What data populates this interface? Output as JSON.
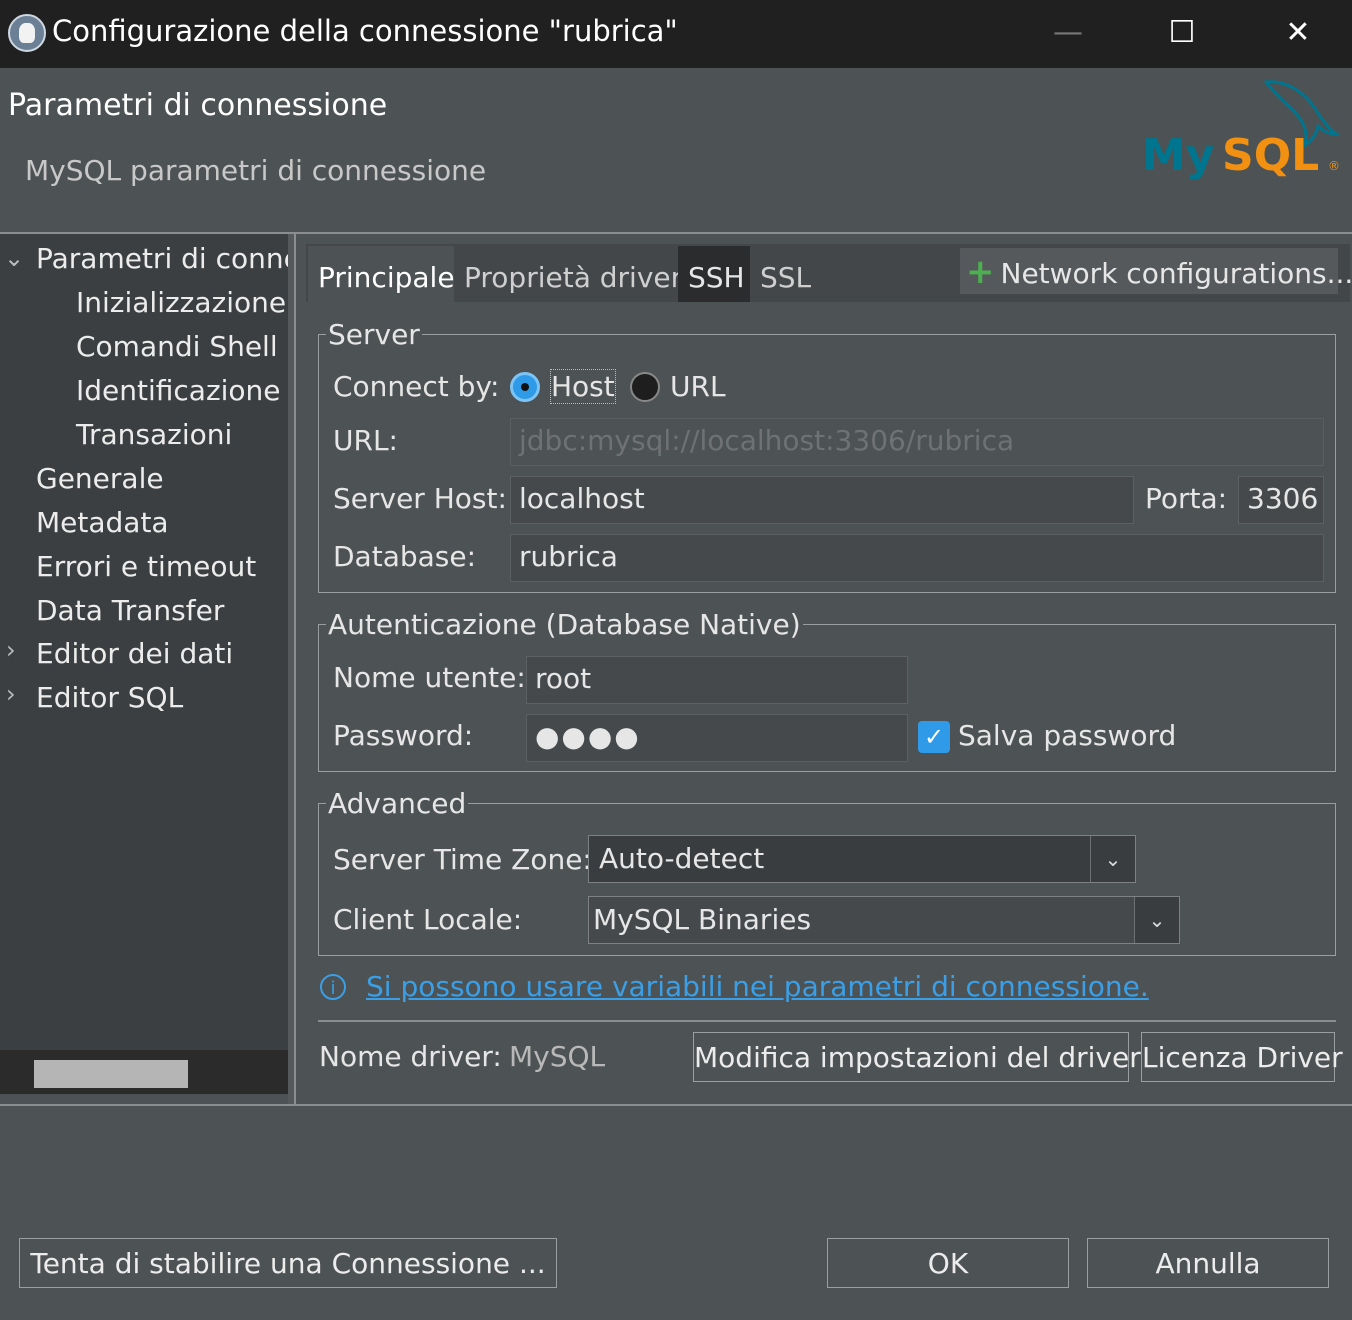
{
  "window": {
    "title": "Configurazione della connessione \"rubrica\"",
    "minimize": "—",
    "maximize": "☐",
    "close": "✕"
  },
  "header": {
    "title": "Parametri di connessione",
    "subtitle": "MySQL parametri di connessione",
    "logo_text": "MySQL"
  },
  "nav": {
    "items": [
      {
        "label": "Parametri di connes",
        "expanded": true
      },
      {
        "label": "Inizializzazione"
      },
      {
        "label": "Comandi Shell"
      },
      {
        "label": "Identificazione c"
      },
      {
        "label": "Transazioni"
      },
      {
        "label": "Generale"
      },
      {
        "label": "Metadata"
      },
      {
        "label": "Errori e timeout"
      },
      {
        "label": "Data Transfer"
      },
      {
        "label": "Editor dei dati",
        "collapsed": true
      },
      {
        "label": "Editor SQL",
        "collapsed": true
      }
    ]
  },
  "tabs": {
    "principale": "Principale",
    "driver": "Proprietà driver",
    "ssh": "SSH",
    "ssl": "SSL",
    "network": "Network configurations..."
  },
  "server": {
    "legend": "Server",
    "connect_by_label": "Connect by:",
    "host_option": "Host",
    "url_option": "URL",
    "url_label": "URL:",
    "url_value": "jdbc:mysql://localhost:3306/rubrica",
    "host_label": "Server Host:",
    "host_value": "localhost",
    "port_label": "Porta:",
    "port_value": "3306",
    "db_label": "Database:",
    "db_value": "rubrica"
  },
  "auth": {
    "legend": "Autenticazione (Database Native)",
    "user_label": "Nome utente:",
    "user_value": "root",
    "password_label": "Password:",
    "password_value": "●●●●",
    "save_password": "Salva password",
    "save_password_checked": true
  },
  "advanced": {
    "legend": "Advanced",
    "tz_label": "Server Time Zone:",
    "tz_value": "Auto-detect",
    "locale_label": "Client Locale:",
    "locale_value": "MySQL Binaries"
  },
  "info": {
    "link": "Si possono usare variabili nei parametri di connessione."
  },
  "driver": {
    "name_label": "Nome driver:",
    "name_value": "MySQL",
    "edit_button": "Modifica impostazioni del driver",
    "license_button": "Licenza Driver"
  },
  "footer": {
    "test_button": "Tenta di stabilire una Connessione ...",
    "ok_button": "OK",
    "cancel_button": "Annulla"
  },
  "colors": {
    "accent": "#2f9be8",
    "link": "#3a9fe6",
    "mysql_blue": "#00758f",
    "mysql_orange": "#f29111"
  }
}
